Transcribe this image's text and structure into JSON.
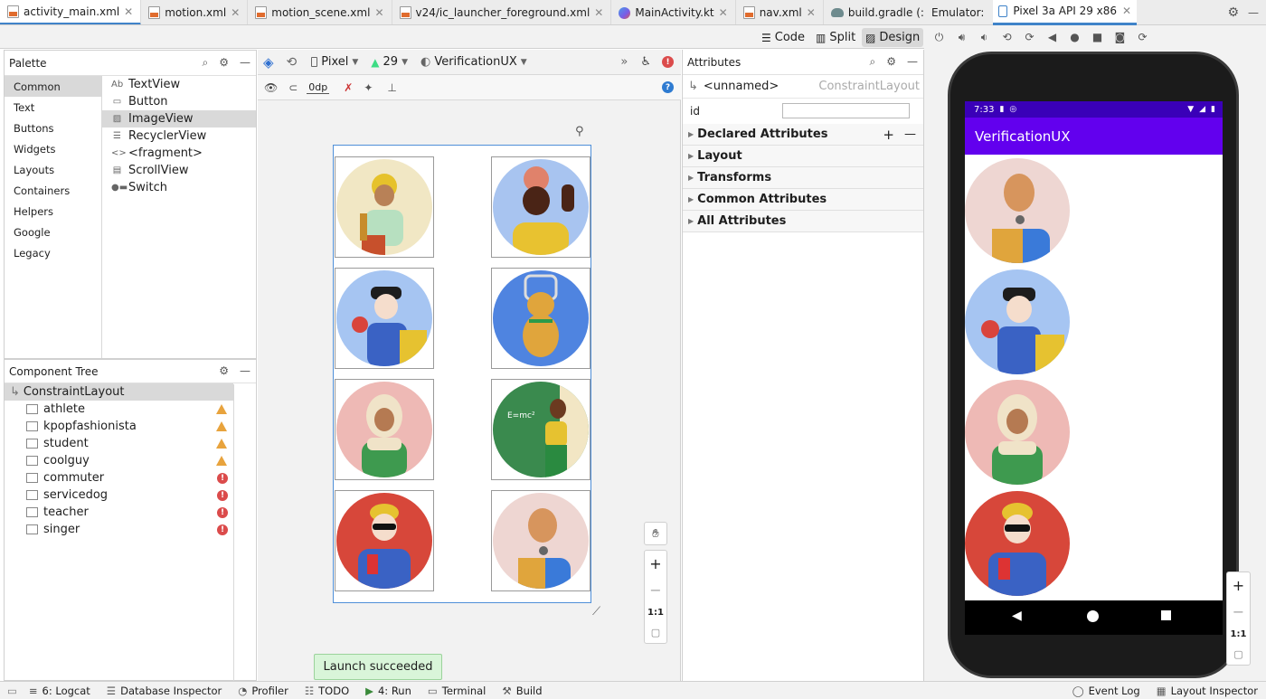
{
  "tabs": [
    {
      "label": "activity_main.xml",
      "icon": "xml-file-icon",
      "active": true
    },
    {
      "label": "motion.xml",
      "icon": "xml-file-icon"
    },
    {
      "label": "motion_scene.xml",
      "icon": "xml-file-icon"
    },
    {
      "label": "v24/ic_launcher_foreground.xml",
      "icon": "xml-file-icon"
    },
    {
      "label": "MainActivity.kt",
      "icon": "kotlin-file-icon"
    },
    {
      "label": "nav.xml",
      "icon": "xml-file-icon"
    },
    {
      "label": "build.gradle (:app)",
      "icon": "gradle-file-icon"
    }
  ],
  "emulator": {
    "label": "Emulator:",
    "device_tab": "Pixel 3a API 29 x86",
    "status_time": "7:33",
    "app_title": "VerificationUX"
  },
  "modes": {
    "code": "Code",
    "split": "Split",
    "design": "Design"
  },
  "palette": {
    "title": "Palette",
    "categories": [
      "Common",
      "Text",
      "Buttons",
      "Widgets",
      "Layouts",
      "Containers",
      "Helpers",
      "Google",
      "Legacy"
    ],
    "items": [
      {
        "icon": "Ab",
        "label": "TextView"
      },
      {
        "icon": "▭",
        "label": "Button"
      },
      {
        "icon": "▨",
        "label": "ImageView"
      },
      {
        "icon": "☰",
        "label": "RecyclerView"
      },
      {
        "icon": "<>",
        "label": "<fragment>"
      },
      {
        "icon": "▤",
        "label": "ScrollView"
      },
      {
        "icon": "●▬",
        "label": "Switch"
      }
    ]
  },
  "component_tree": {
    "title": "Component Tree",
    "root": "ConstraintLayout",
    "children": [
      {
        "label": "athlete",
        "status": "warning"
      },
      {
        "label": "kpopfashionista",
        "status": "warning"
      },
      {
        "label": "student",
        "status": "warning"
      },
      {
        "label": "coolguy",
        "status": "warning"
      },
      {
        "label": "commuter",
        "status": "error"
      },
      {
        "label": "servicedog",
        "status": "error"
      },
      {
        "label": "teacher",
        "status": "error"
      },
      {
        "label": "singer",
        "status": "error"
      }
    ]
  },
  "design_toolbar": {
    "device": "Pixel",
    "api": "29",
    "theme": "VerificationUX",
    "margin": "0dp"
  },
  "attributes": {
    "title": "Attributes",
    "component": "<unnamed>",
    "component_type": "ConstraintLayout",
    "id_label": "id",
    "id_value": "",
    "sections": [
      "Declared Attributes",
      "Layout",
      "Transforms",
      "Common Attributes",
      "All Attributes"
    ]
  },
  "zoom": {
    "one_to_one": "1:1"
  },
  "toast": "Launch succeeded",
  "bottom_bar": [
    {
      "label": "6: Logcat",
      "icon": "logcat-icon"
    },
    {
      "label": "Database Inspector",
      "icon": "database-icon"
    },
    {
      "label": "Profiler",
      "icon": "profiler-icon"
    },
    {
      "label": "TODO",
      "icon": "todo-icon"
    },
    {
      "label": "4: Run",
      "icon": "run-icon"
    },
    {
      "label": "Terminal",
      "icon": "terminal-icon"
    },
    {
      "label": "Build",
      "icon": "build-icon"
    }
  ],
  "bottom_bar_right": [
    {
      "label": "Event Log",
      "icon": "event-log-icon"
    },
    {
      "label": "Layout Inspector",
      "icon": "layout-inspector-icon"
    }
  ],
  "colors": {
    "accent": "#4083c9",
    "app_primary": "#6200ee",
    "warning": "#e8a33d",
    "error": "#db4b4b"
  }
}
